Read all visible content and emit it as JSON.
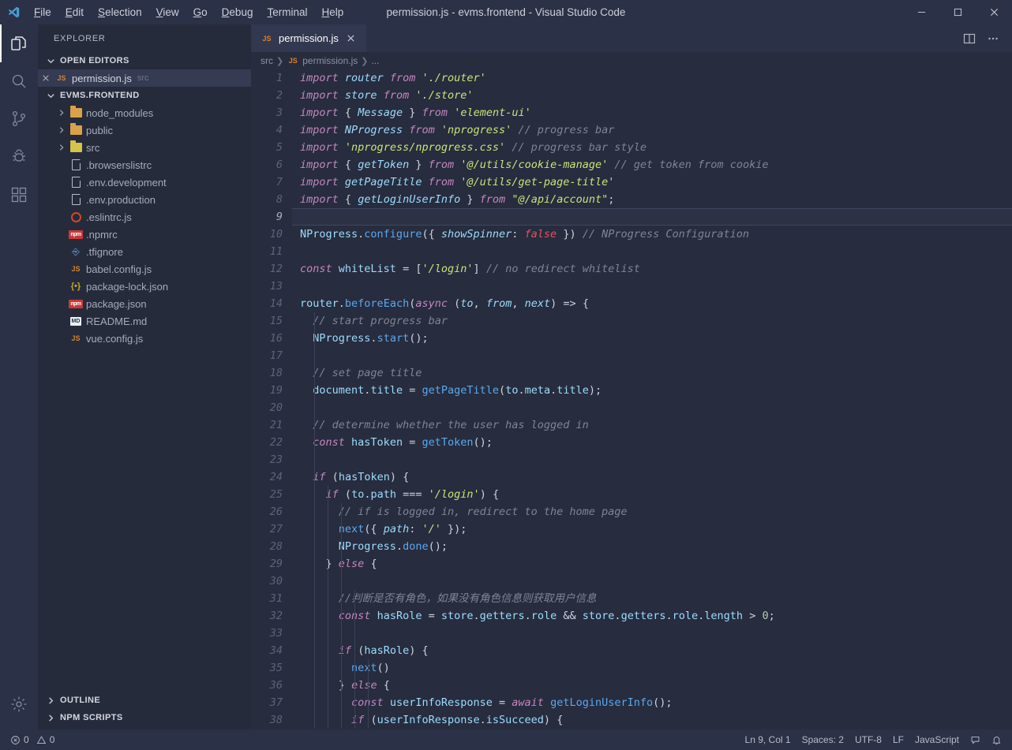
{
  "titlebar": {
    "window_title": "permission.js - evms.frontend - Visual Studio Code",
    "menus": [
      {
        "label": "File",
        "accel": "F"
      },
      {
        "label": "Edit",
        "accel": "E"
      },
      {
        "label": "Selection",
        "accel": "S"
      },
      {
        "label": "View",
        "accel": "V"
      },
      {
        "label": "Go",
        "accel": "G"
      },
      {
        "label": "Debug",
        "accel": "D"
      },
      {
        "label": "Terminal",
        "accel": "T"
      },
      {
        "label": "Help",
        "accel": "H"
      }
    ]
  },
  "activitybar": {
    "items": [
      {
        "name": "explorer",
        "icon": "files-icon",
        "active": true
      },
      {
        "name": "search",
        "icon": "search-icon",
        "active": false
      },
      {
        "name": "source-control",
        "icon": "source-control-icon",
        "active": false
      },
      {
        "name": "run-debug",
        "icon": "debug-icon",
        "active": false
      },
      {
        "name": "extensions",
        "icon": "extensions-icon",
        "active": false
      }
    ],
    "settings_icon": "gear-icon"
  },
  "sidebar": {
    "title": "EXPLORER",
    "open_editors": {
      "label": "OPEN EDITORS",
      "expanded": true,
      "items": [
        {
          "label": "permission.js",
          "sub": "src",
          "icon": "js-icon",
          "selected": true
        }
      ]
    },
    "workspace": {
      "label": "EVMS.FRONTEND",
      "expanded": true,
      "items": [
        {
          "label": "node_modules",
          "type": "folder",
          "icon": "folder-js-icon",
          "color": "#d9a24a",
          "expandable": true
        },
        {
          "label": "public",
          "type": "folder",
          "icon": "folder-icon",
          "color": "#d9a24a",
          "expandable": true
        },
        {
          "label": "src",
          "type": "folder",
          "icon": "folder-src-icon",
          "color": "#d4c44a",
          "expandable": true
        },
        {
          "label": ".browserslistrc",
          "type": "file",
          "icon": "doc-icon"
        },
        {
          "label": ".env.development",
          "type": "file",
          "icon": "doc-icon"
        },
        {
          "label": ".env.production",
          "type": "file",
          "icon": "doc-icon"
        },
        {
          "label": ".eslintrc.js",
          "type": "file",
          "icon": "eslint-icon"
        },
        {
          "label": ".npmrc",
          "type": "file",
          "icon": "npm-icon"
        },
        {
          "label": ".tfignore",
          "type": "file",
          "icon": "tfignore-icon"
        },
        {
          "label": "babel.config.js",
          "type": "file",
          "icon": "js-icon"
        },
        {
          "label": "package-lock.json",
          "type": "file",
          "icon": "json-icon"
        },
        {
          "label": "package.json",
          "type": "file",
          "icon": "npm-icon"
        },
        {
          "label": "README.md",
          "type": "file",
          "icon": "markdown-icon"
        },
        {
          "label": "vue.config.js",
          "type": "file",
          "icon": "js-icon"
        }
      ]
    },
    "outline": {
      "label": "OUTLINE",
      "expanded": false
    },
    "npm_scripts": {
      "label": "NPM SCRIPTS",
      "expanded": false
    }
  },
  "editor": {
    "tab": {
      "label": "permission.js",
      "icon": "js-icon",
      "close_icon": "close-icon",
      "active": true
    },
    "actions": [
      {
        "name": "split-editor",
        "icon": "split-editor-icon"
      },
      {
        "name": "more-actions",
        "icon": "ellipsis-icon"
      }
    ],
    "breadcrumb": [
      "src",
      "permission.js",
      "..."
    ],
    "current_line": 9,
    "first_line": 1,
    "last_line": 38,
    "lines": [
      {
        "n": 1,
        "html": "<span class=\"kw\">import</span> <span class=\"var-i\">router</span> <span class=\"kw\">from</span> <span class=\"str\">'./router'</span>"
      },
      {
        "n": 2,
        "html": "<span class=\"kw\">import</span> <span class=\"var-i\">store</span> <span class=\"kw\">from</span> <span class=\"str\">'./store'</span>"
      },
      {
        "n": 3,
        "html": "<span class=\"kw\">import</span> <span class=\"punc\">{</span> <span class=\"var-i\">Message</span> <span class=\"punc\">}</span> <span class=\"kw\">from</span> <span class=\"str\">'element-ui'</span>"
      },
      {
        "n": 4,
        "html": "<span class=\"kw\">import</span> <span class=\"var-i\">NProgress</span> <span class=\"kw\">from</span> <span class=\"str\">'nprogress'</span> <span class=\"cmt\">// progress bar</span>"
      },
      {
        "n": 5,
        "html": "<span class=\"kw\">import</span> <span class=\"str\">'nprogress/nprogress.css'</span> <span class=\"cmt\">// progress bar style</span>"
      },
      {
        "n": 6,
        "html": "<span class=\"kw\">import</span> <span class=\"punc\">{</span> <span class=\"var-i\">getToken</span> <span class=\"punc\">}</span> <span class=\"kw\">from</span> <span class=\"str\">'@/utils/cookie-manage'</span> <span class=\"cmt\">// get token from cookie</span>"
      },
      {
        "n": 7,
        "html": "<span class=\"kw\">import</span> <span class=\"var-i\">getPageTitle</span> <span class=\"kw\">from</span> <span class=\"str\">'@/utils/get-page-title'</span>"
      },
      {
        "n": 8,
        "html": "<span class=\"kw\">import</span> <span class=\"punc\">{</span> <span class=\"var-i\">getLoginUserInfo</span> <span class=\"punc\">}</span> <span class=\"kw\">from</span> <span class=\"str\">\"@/api/account\"</span><span class=\"punc\">;</span>"
      },
      {
        "n": 9,
        "html": ""
      },
      {
        "n": 10,
        "html": "<span class=\"var\">NProgress</span><span class=\"punc\">.</span><span class=\"fn\">configure</span><span class=\"punc\">({</span> <span class=\"var-i\">showSpinner</span><span class=\"punc\">:</span> <span class=\"lit\">false</span> <span class=\"punc\">})</span> <span class=\"cmt\">// NProgress Configuration</span>"
      },
      {
        "n": 11,
        "html": ""
      },
      {
        "n": 12,
        "html": "<span class=\"kw\">const</span> <span class=\"var\">whiteList</span> <span class=\"op\">=</span> <span class=\"punc\">[</span><span class=\"str\">'/login'</span><span class=\"punc\">]</span> <span class=\"cmt\">// no redirect whitelist</span>"
      },
      {
        "n": 13,
        "html": ""
      },
      {
        "n": 14,
        "html": "<span class=\"var\">router</span><span class=\"punc\">.</span><span class=\"fn\">beforeEach</span><span class=\"punc\">(</span><span class=\"kw\">async</span> <span class=\"punc\">(</span><span class=\"var-i\">to</span><span class=\"punc\">,</span> <span class=\"var-i\">from</span><span class=\"punc\">,</span> <span class=\"var-i\">next</span><span class=\"punc\">)</span> <span class=\"op\">=&gt;</span> <span class=\"punc\">{</span>"
      },
      {
        "n": 15,
        "html": "  <span class=\"cmt\">// start progress bar</span>"
      },
      {
        "n": 16,
        "html": "  <span class=\"var\">NProgress</span><span class=\"punc\">.</span><span class=\"fn\">start</span><span class=\"punc\">();</span>"
      },
      {
        "n": 17,
        "html": ""
      },
      {
        "n": 18,
        "html": "  <span class=\"cmt\">// set page title</span>"
      },
      {
        "n": 19,
        "html": "  <span class=\"var\">document</span><span class=\"punc\">.</span><span class=\"prop\">title</span> <span class=\"op\">=</span> <span class=\"fn\">getPageTitle</span><span class=\"punc\">(</span><span class=\"var\">to</span><span class=\"punc\">.</span><span class=\"prop\">meta</span><span class=\"punc\">.</span><span class=\"prop\">title</span><span class=\"punc\">);</span>"
      },
      {
        "n": 20,
        "html": ""
      },
      {
        "n": 21,
        "html": "  <span class=\"cmt\">// determine whether the user has logged in</span>"
      },
      {
        "n": 22,
        "html": "  <span class=\"kw\">const</span> <span class=\"var\">hasToken</span> <span class=\"op\">=</span> <span class=\"fn\">getToken</span><span class=\"punc\">();</span>"
      },
      {
        "n": 23,
        "html": ""
      },
      {
        "n": 24,
        "html": "  <span class=\"kw\">if</span> <span class=\"punc\">(</span><span class=\"var\">hasToken</span><span class=\"punc\">)</span> <span class=\"punc\">{</span>"
      },
      {
        "n": 25,
        "html": "    <span class=\"kw\">if</span> <span class=\"punc\">(</span><span class=\"var\">to</span><span class=\"punc\">.</span><span class=\"prop\">path</span> <span class=\"op\">===</span> <span class=\"str\">'/login'</span><span class=\"punc\">)</span> <span class=\"punc\">{</span>"
      },
      {
        "n": 26,
        "html": "      <span class=\"cmt\">// if is logged in, redirect to the home page</span>"
      },
      {
        "n": 27,
        "html": "      <span class=\"fn\">next</span><span class=\"punc\">({</span> <span class=\"var-i\">path</span><span class=\"punc\">:</span> <span class=\"str\">'/'</span> <span class=\"punc\">});</span>"
      },
      {
        "n": 28,
        "html": "      <span class=\"var\">NProgress</span><span class=\"punc\">.</span><span class=\"fn\">done</span><span class=\"punc\">();</span>"
      },
      {
        "n": 29,
        "html": "    <span class=\"punc\">}</span> <span class=\"kw\">else</span> <span class=\"punc\">{</span>"
      },
      {
        "n": 30,
        "html": ""
      },
      {
        "n": 31,
        "html": "      <span class=\"cmt\">//判断是否有角色，如果没有角色信息则获取用户信息</span>"
      },
      {
        "n": 32,
        "html": "      <span class=\"kw\">const</span> <span class=\"var\">hasRole</span> <span class=\"op\">=</span> <span class=\"var\">store</span><span class=\"punc\">.</span><span class=\"prop\">getters</span><span class=\"punc\">.</span><span class=\"prop\">role</span> <span class=\"op\">&amp;&amp;</span> <span class=\"var\">store</span><span class=\"punc\">.</span><span class=\"prop\">getters</span><span class=\"punc\">.</span><span class=\"prop\">role</span><span class=\"punc\">.</span><span class=\"prop\">length</span> <span class=\"op\">&gt;</span> <span class=\"num\">0</span><span class=\"punc\">;</span>"
      },
      {
        "n": 33,
        "html": ""
      },
      {
        "n": 34,
        "html": "      <span class=\"kw\">if</span> <span class=\"punc\">(</span><span class=\"var\">hasRole</span><span class=\"punc\">)</span> <span class=\"punc\">{</span>"
      },
      {
        "n": 35,
        "html": "        <span class=\"fn\">next</span><span class=\"punc\">()</span>"
      },
      {
        "n": 36,
        "html": "      <span class=\"punc\">}</span> <span class=\"kw\">else</span> <span class=\"punc\">{</span>"
      },
      {
        "n": 37,
        "html": "        <span class=\"kw\">const</span> <span class=\"var\">userInfoResponse</span> <span class=\"op\">=</span> <span class=\"kw\">await</span> <span class=\"fn\">getLoginUserInfo</span><span class=\"punc\">();</span>"
      },
      {
        "n": 38,
        "html": "        <span class=\"kw\">if</span> <span class=\"punc\">(</span><span class=\"var\">userInfoResponse</span><span class=\"punc\">.</span><span class=\"prop\">isSucceed</span><span class=\"punc\">)</span> <span class=\"punc\">{</span>"
      }
    ]
  },
  "statusbar": {
    "errors": "0",
    "warnings": "0",
    "position": "Ln 9, Col 1",
    "indentation": "Spaces: 2",
    "encoding": "UTF-8",
    "eol": "LF",
    "language": "JavaScript",
    "feedback_icon": "feedback-icon",
    "bell_icon": "bell-icon"
  },
  "colors": {
    "titlebar_bg": "#2b3146",
    "sidebar_bg": "#262b3c",
    "editor_bg": "#272c3e",
    "activitybar_bg": "#2b3146",
    "accent": "#ffffff",
    "keyword": "#c586c0",
    "string": "#cde37a",
    "comment": "#7f8595",
    "function": "#5aa9f0",
    "variable": "#9cdcfe"
  }
}
